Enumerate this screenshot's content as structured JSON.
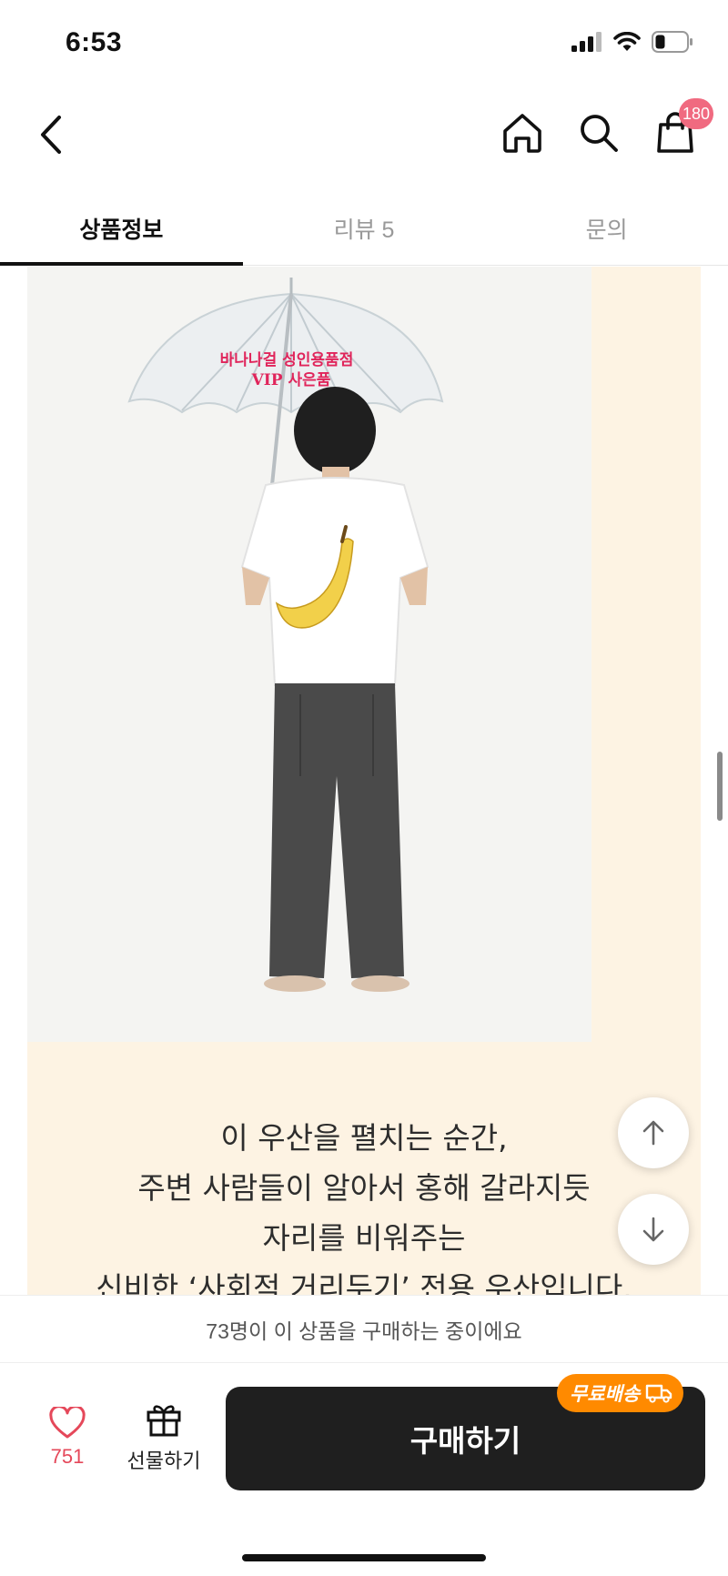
{
  "status_bar": {
    "time": "6:53"
  },
  "header": {
    "icons": [
      "back-arrow",
      "home",
      "search",
      "shopping-bag"
    ],
    "cart_badge": "180"
  },
  "tabs": [
    {
      "label": "상품정보",
      "active": true
    },
    {
      "label": "리뷰 5",
      "active": false
    },
    {
      "label": "문의",
      "active": false
    }
  ],
  "product_image": {
    "umbrella_text_line1": "바나나걸 성인용품점",
    "umbrella_text_line2": "VIP 사은품"
  },
  "description": {
    "lines": [
      "이 우산을 펼치는 순간,",
      "주변 사람들이 알아서 홍해 갈라지듯",
      "자리를 비워주는",
      "신비한 ‘사회적 거리두기’ 전용 우산입니다."
    ]
  },
  "purchase_notice": "73명이 이 상품을 구매하는 중이에요",
  "bottom_bar": {
    "like_count": "751",
    "gift_label": "선물하기",
    "buy_label": "구매하기",
    "shipping_badge": "무료배송"
  },
  "colors": {
    "accent_pink": "#f06a80",
    "like_red": "#e5485a",
    "shipping_orange": "#ff8a00",
    "panel_cream": "#fdf3e3",
    "buy_button": "#1f1f1f"
  }
}
